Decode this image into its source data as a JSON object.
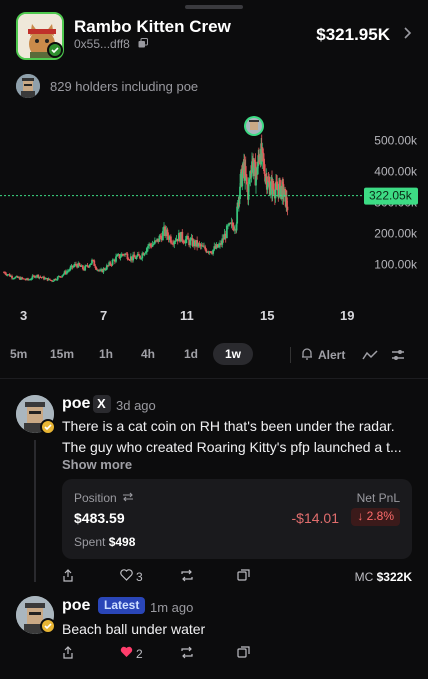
{
  "token": {
    "name": "Rambo Kitten Crew",
    "address": "0x55...dff8",
    "market_cap": "$321.95K"
  },
  "holders": {
    "text": "829 holders including poe"
  },
  "chart_data": {
    "type": "candlestick",
    "title": "",
    "xlabel": "",
    "ylabel": "",
    "x_ticks": [
      "3",
      "7",
      "11",
      "15",
      "19"
    ],
    "y_ticks": [
      "500.00k",
      "400.00k",
      "300.00k",
      "200.00k",
      "100.00k"
    ],
    "ylim": [
      40000,
      540000
    ],
    "current_price_label": "322.05k",
    "current_price": 322050,
    "price_path": [
      [
        2.0,
        75000
      ],
      [
        2.4,
        60000
      ],
      [
        2.8,
        55000
      ],
      [
        3.2,
        50000
      ],
      [
        3.6,
        65000
      ],
      [
        4.0,
        55000
      ],
      [
        4.4,
        48000
      ],
      [
        4.8,
        62000
      ],
      [
        5.2,
        80000
      ],
      [
        5.6,
        100000
      ],
      [
        6.0,
        85000
      ],
      [
        6.4,
        110000
      ],
      [
        6.8,
        75000
      ],
      [
        7.2,
        95000
      ],
      [
        7.6,
        120000
      ],
      [
        8.0,
        135000
      ],
      [
        8.4,
        120000
      ],
      [
        8.8,
        125000
      ],
      [
        9.2,
        160000
      ],
      [
        9.6,
        170000
      ],
      [
        10.0,
        205000
      ],
      [
        10.4,
        180000
      ],
      [
        10.8,
        190000
      ],
      [
        11.2,
        175000
      ],
      [
        11.6,
        165000
      ],
      [
        12.0,
        150000
      ],
      [
        12.4,
        145000
      ],
      [
        12.8,
        160000
      ],
      [
        13.2,
        215000
      ],
      [
        13.6,
        230000
      ],
      [
        13.8,
        360000
      ],
      [
        14.0,
        410000
      ],
      [
        14.2,
        330000
      ],
      [
        14.4,
        440000
      ],
      [
        14.6,
        380000
      ],
      [
        14.8,
        470000
      ],
      [
        15.0,
        410000
      ],
      [
        15.2,
        360000
      ],
      [
        15.4,
        350000
      ],
      [
        15.6,
        340000
      ],
      [
        15.8,
        345000
      ],
      [
        16.0,
        330000
      ],
      [
        16.2,
        280000
      ]
    ]
  },
  "timeframes": [
    "5m",
    "15m",
    "1h",
    "4h",
    "1d",
    "1w"
  ],
  "active_timeframe": "1w",
  "alert_label": "Alert",
  "comments": [
    {
      "user": "poe",
      "time": "3d ago",
      "lines": [
        "There is a cat coin on RH that's been under the radar.",
        "The guy who created Roaring Kitty's pfp launched a t..."
      ],
      "show_more": "Show more",
      "position": {
        "label": "Position",
        "value": "$483.59",
        "spent_label": "Spent",
        "spent": "$498",
        "pnl_label": "Net PnL",
        "pnl": "-$14.01",
        "pnl_pct": "↓ 2.8%"
      },
      "likes": "3",
      "mc_label": "MC",
      "mc": "$322K"
    },
    {
      "user": "poe",
      "badge": "Latest",
      "time": "1m ago",
      "text": "Beach ball under water",
      "likes": "2"
    }
  ],
  "colors": {
    "up": "#37c37a",
    "down": "#e45b5b",
    "price_line": "#3ddc84",
    "like_active": "#ff3d6b"
  }
}
